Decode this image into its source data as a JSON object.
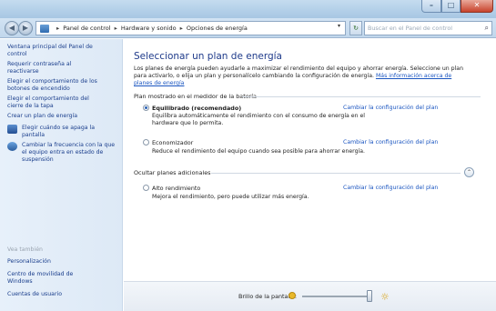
{
  "window": {
    "controls": {
      "minimize": "–",
      "maximize": "□",
      "close": "✕"
    }
  },
  "nav": {
    "back": "◀",
    "forward": "▶",
    "breadcrumb": [
      "Panel de control",
      "Hardware y sonido",
      "Opciones de energía"
    ],
    "breadcrumb_sep": "▸",
    "search_placeholder": "Buscar en el Panel de control"
  },
  "sidebar": {
    "items": [
      {
        "label": "Ventana principal del Panel de control"
      },
      {
        "label": "Requerir contraseña al reactivarse"
      },
      {
        "label": "Elegir el comportamiento de los botones de encendido"
      },
      {
        "label": "Elegir el comportamiento del cierre de la tapa"
      },
      {
        "label": "Crear un plan de energía"
      },
      {
        "label": "Elegir cuándo se apaga la pantalla"
      },
      {
        "label": "Cambiar la frecuencia con la que el equipo entra en estado de suspensión"
      }
    ],
    "see_also_title": "Vea también",
    "see_also": [
      {
        "label": "Personalización"
      },
      {
        "label": "Centro de movilidad de Windows"
      },
      {
        "label": "Cuentas de usuario"
      }
    ]
  },
  "main": {
    "title": "Seleccionar un plan de energía",
    "description": "Los planes de energía pueden ayudarle a maximizar el rendimiento del equipo y ahorrar energía. Seleccione un plan para activarlo, o elija un plan y personalícelo cambiando la configuración de energía.",
    "description_link": "Más información acerca de planes de energía",
    "section_shown": "Plan mostrado en el medidor de la batería",
    "section_hidden": "Ocultar planes adicionales",
    "change_link": "Cambiar la configuración del plan",
    "plans": [
      {
        "name": "Equilibrado (recomendado)",
        "selected": true,
        "description": "Equilibra automáticamente el rendimiento con el consumo de energía en el hardware que lo permita."
      },
      {
        "name": "Economizador",
        "selected": false,
        "description": "Reduce el rendimiento del equipo cuando sea posible para ahorrar energía."
      },
      {
        "name": "Alto rendimiento",
        "selected": false,
        "description": "Mejora el rendimiento, pero puede utilizar más energía."
      }
    ],
    "collapse": "⌃"
  },
  "bottom": {
    "brightness_label": "Brillo de la pantalla:"
  },
  "colors": {
    "link": "#1a55c0",
    "title": "#1e3a8a",
    "sidebar_bg": "#e3edf8"
  }
}
